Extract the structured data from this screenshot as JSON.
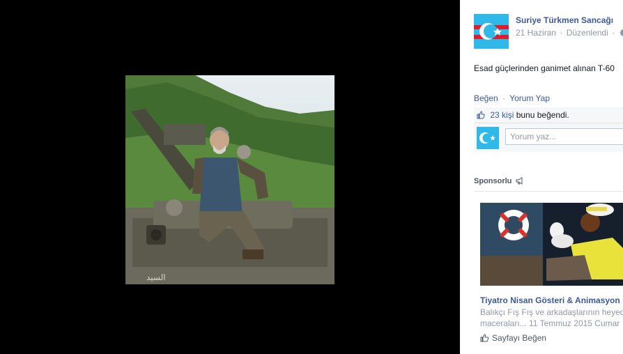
{
  "post": {
    "page_name": "Suriye Türkmen Sancağı",
    "date": "21 Haziran",
    "meta_separator": "·",
    "edited": "Düzenlendi",
    "caption": "Esad güçlerinden ganimet alınan T-60"
  },
  "actions": {
    "like": "Beğen",
    "separator": "·",
    "comment": "Yorum Yap"
  },
  "likes": {
    "count": "23 kişi",
    "suffix": " bunu beğendi."
  },
  "comment_box": {
    "placeholder": "Yorum yaz..."
  },
  "sponsored": {
    "heading": "Sponsorlu",
    "ad_title": "Tiyatro Nisan Gösteri & Animasyon",
    "ad_desc_line1": "Balıkçı Fış Fış ve arkadaşlarının heyed",
    "ad_desc_line2": "maceraları... 11 Temmuz 2015 Cumar",
    "page_like": "Sayfayı Beğen"
  },
  "colors": {
    "link": "#3b5998",
    "meta_gray": "#9197a3",
    "ufi_background": "#f6f7f8",
    "viewer_background": "#000000"
  },
  "icons": {
    "globe": "globe-icon",
    "thumbs_up": "thumbs-up-icon",
    "megaphone": "megaphone-icon"
  }
}
